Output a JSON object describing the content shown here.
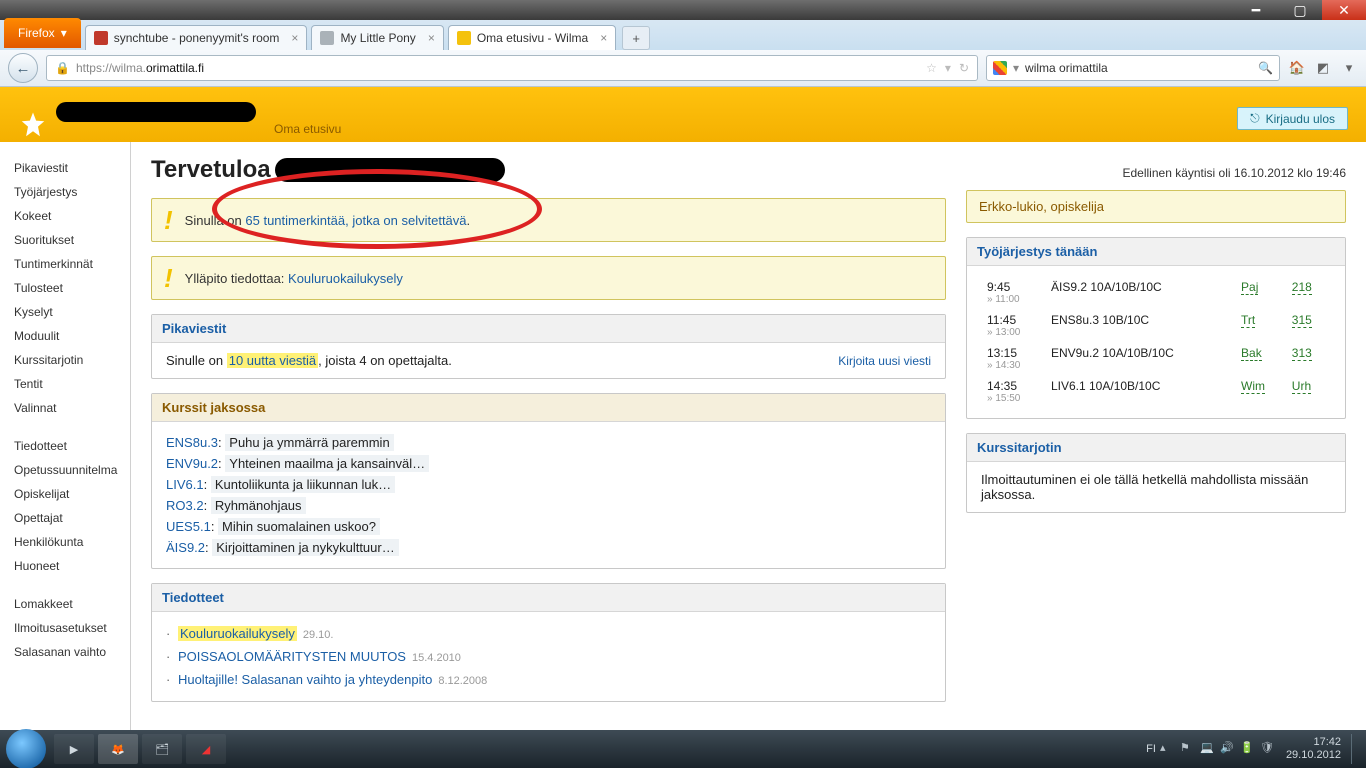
{
  "window": {
    "firefox_label": "Firefox",
    "tabs": [
      {
        "title": "synchtube - ponenyymit's room",
        "favicon": "#c0392b"
      },
      {
        "title": "My Little Pony",
        "favicon": "#aab2b8"
      },
      {
        "title": "Oma etusivu - Wilma",
        "favicon": "#f4c20d",
        "active": true
      }
    ],
    "url_display_prefix": "https://",
    "url_display_sub": "wilma.",
    "url_display_host": "orimattila.fi",
    "search_value": "wilma orimattila"
  },
  "header": {
    "home_link": "Oma etusivu",
    "logout": "Kirjaudu ulos"
  },
  "sidebar": {
    "group1": [
      "Pikaviestit",
      "Työjärjestys",
      "Kokeet",
      "Suoritukset",
      "Tuntimerkinnät",
      "Tulosteet",
      "Kyselyt",
      "Moduulit",
      "Kurssitarjotin",
      "Tentit",
      "Valinnat"
    ],
    "group2": [
      "Tiedotteet",
      "Opetussuunnitelma",
      "Opiskelijat",
      "Opettajat",
      "Henkilökunta",
      "Huoneet"
    ],
    "group3": [
      "Lomakkeet",
      "Ilmoitusasetukset",
      "Salasanan vaihto"
    ]
  },
  "main": {
    "welcome_prefix": "Tervetuloa",
    "last_login": "Edellinen käyntisi oli 16.10.2012 klo 19:46",
    "alert1_before": "Sinulla on ",
    "alert1_link": "65 tuntimerkintää, jotka on selvitettävä",
    "alert1_after": ".",
    "alert2_before": "Ylläpito tiedottaa: ",
    "alert2_link": "Kouluruokailukysely",
    "messages": {
      "heading": "Pikaviestit",
      "before": "Sinulle on ",
      "link": "10 uutta viestiä",
      "after": ", joista 4 on opettajalta.",
      "write": "Kirjoita uusi viesti"
    },
    "courses": {
      "heading": "Kurssit jaksossa",
      "items": [
        {
          "code": "ENS8u.3",
          "name": "Puhu ja ymmärrä paremmin"
        },
        {
          "code": "ENV9u.2",
          "name": "Yhteinen maailma ja kansainväl…"
        },
        {
          "code": "LIV6.1",
          "name": "Kuntoliikunta ja liikunnan luk…"
        },
        {
          "code": "RO3.2",
          "name": "Ryhmänohjaus"
        },
        {
          "code": "UES5.1",
          "name": "Mihin suomalainen uskoo?"
        },
        {
          "code": "ÄIS9.2",
          "name": "Kirjoittaminen ja nykykulttuur…"
        }
      ]
    },
    "bulletins": {
      "heading": "Tiedotteet",
      "items": [
        {
          "title": "Kouluruokailukysely",
          "date": "29.10.",
          "hl": true
        },
        {
          "title": "POISSAOLOMÄÄRITYSTEN MUUTOS",
          "date": "15.4.2010"
        },
        {
          "title": "Huoltajille! Salasanan vaihto ja yhteydenpito",
          "date": "8.12.2008"
        }
      ]
    }
  },
  "right": {
    "role": "Erkko-lukio, opiskelija",
    "tt_heading": "Työjärjestys tänään",
    "timetable": [
      {
        "start": "9:45",
        "end": "11:00",
        "course": "ÄIS9.2 10A/10B/10C",
        "teacher": "Paj",
        "room": "218"
      },
      {
        "start": "11:45",
        "end": "13:00",
        "course": "ENS8u.3 10B/10C",
        "teacher": "Trt",
        "room": "315"
      },
      {
        "start": "13:15",
        "end": "14:30",
        "course": "ENV9u.2 10A/10B/10C",
        "teacher": "Bak",
        "room": "313"
      },
      {
        "start": "14:35",
        "end": "15:50",
        "course": "LIV6.1 10A/10B/10C",
        "teacher": "Wim",
        "room": "Urh"
      }
    ],
    "tray_heading": "Kurssitarjotin",
    "tray_text": "Ilmoittautuminen ei ole tällä hetkellä mahdollista missään jaksossa."
  },
  "taskbar": {
    "lang": "FI",
    "time": "17:42",
    "date": "29.10.2012"
  }
}
